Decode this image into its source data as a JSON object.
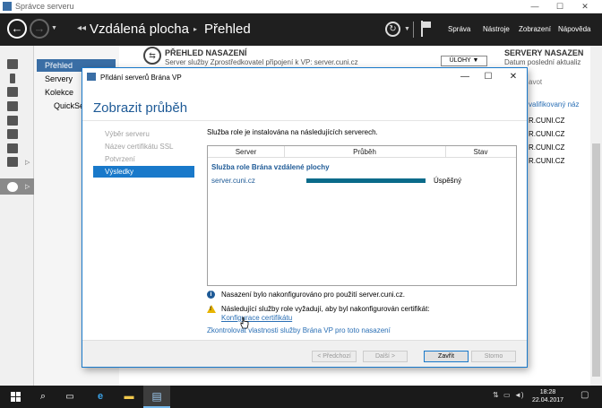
{
  "window": {
    "title": "Správce serveru",
    "controls": {
      "minimize": "—",
      "maximize": "☐",
      "close": "✕"
    }
  },
  "header": {
    "breadcrumb": [
      "Vzdálená plocha",
      "Přehled"
    ],
    "menu": [
      "Správa",
      "Nástroje",
      "Zobrazení",
      "Nápověda"
    ]
  },
  "left_nav": {
    "items": [
      "Přehled",
      "Servery",
      "Kolekce",
      "QuickSe"
    ]
  },
  "main": {
    "tile": {
      "title": "PŘEHLED NASAZENÍ",
      "subtitle": "Server služby Zprostředkovatel připojení k VP: server.cuni.cz",
      "tasks_button": "ÚLOHY"
    },
    "tile2": {
      "title": "SERVERY NASAZEN",
      "subtitle": "Datum poslední aktualiz",
      "filter": "avot",
      "link": "valifikovaný náz",
      "rows": [
        "R.CUNI.CZ",
        "R.CUNI.CZ",
        "R.CUNI.CZ",
        "R.CUNI.CZ"
      ]
    }
  },
  "dialog": {
    "title": "Přidání serverů Brána VP",
    "heading": "Zobrazit průběh",
    "steps": [
      {
        "label": "Výběr serveru",
        "active": false
      },
      {
        "label": "Název certifikátu SSL",
        "active": false
      },
      {
        "label": "Potvrzení",
        "active": false
      },
      {
        "label": "Výsledky",
        "active": true
      }
    ],
    "description": "Služba role je instalována na následujících serverech.",
    "table": {
      "columns": [
        "Server",
        "Průběh",
        "Stav"
      ],
      "group": "Služba role Brána vzdálené plochy",
      "rows": [
        {
          "server": "server.cuni.cz",
          "progress": 1.0,
          "status": "Úspěšný"
        }
      ]
    },
    "info_message": "Nasazení bylo nakonfigurováno pro použití server.cuni.cz.",
    "warning_message": "Následující služby role vyžadují, aby byl nakonfigurován certifikát:",
    "cert_link": "Konfigurace certifikátu",
    "check_link": "Zkontrolovat vlastnosti služby Brána VP pro toto nasazení",
    "buttons": {
      "prev": "< Předchozí",
      "next": "Další >",
      "close": "Zavřít",
      "cancel": "Storno"
    }
  },
  "taskbar": {
    "time": "18:28",
    "date": "22.04.2017"
  },
  "colors": {
    "accent": "#1979ca",
    "header_bg": "#1f1f1f",
    "progress": "#0a6b8a",
    "link": "#2a6fb5"
  }
}
